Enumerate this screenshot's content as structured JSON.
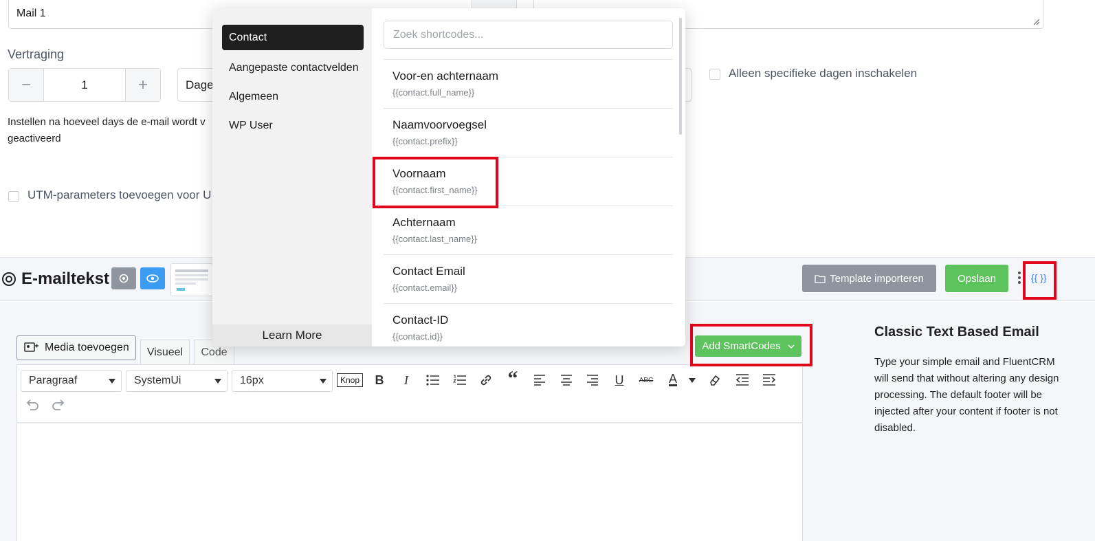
{
  "form": {
    "mail_name": "Mail 1",
    "delay_label": "Vertraging",
    "stepper_value": "1",
    "stepper_minus": "−",
    "stepper_plus": "+",
    "unit": "Dage",
    "days_label": "Alleen specifieke dagen inschakelen",
    "help_text": "Instellen na hoeveel days de e-mail wordt v geactiveerd",
    "utm_label": "UTM-parameters toevoegen voor U"
  },
  "section": {
    "title": "E-mailtekst",
    "import_label": "Template importeren",
    "save_label": "Opslaan",
    "shortcode_button": "{{ }}"
  },
  "editor": {
    "media_label": "Media toevoegen",
    "tabs": [
      "Visueel",
      "Code"
    ],
    "format_select": "Paragraaf",
    "font_select": "SystemUi",
    "size_select": "16px",
    "knop_label": "Knop",
    "smartcodes_label": "Add SmartCodes"
  },
  "sidebar": {
    "title": "Classic Text Based Email",
    "description": "Type your simple email and FluentCRM will send that without altering any design processing. The default footer will be injected after your content if footer is not disabled."
  },
  "popover": {
    "categories": [
      "Contact",
      "Aangepaste contactvelden",
      "Algemeen",
      "WP User"
    ],
    "learn_more": "Learn More",
    "search_placeholder": "Zoek shortcodes...",
    "items": [
      {
        "title": "Voor-en achternaam",
        "code": "{{contact.full_name}}"
      },
      {
        "title": "Naamvoorvoegsel",
        "code": "{{contact.prefix}}"
      },
      {
        "title": "Voornaam",
        "code": "{{contact.first_name}}"
      },
      {
        "title": "Achternaam",
        "code": "{{contact.last_name}}"
      },
      {
        "title": "Contact Email",
        "code": "{{contact.email}}"
      },
      {
        "title": "Contact-ID",
        "code": "{{contact.id}}"
      }
    ]
  },
  "colors": {
    "accent_green": "#5cc35d",
    "accent_blue": "#3b82f6",
    "highlight_red": "#e1061b"
  }
}
